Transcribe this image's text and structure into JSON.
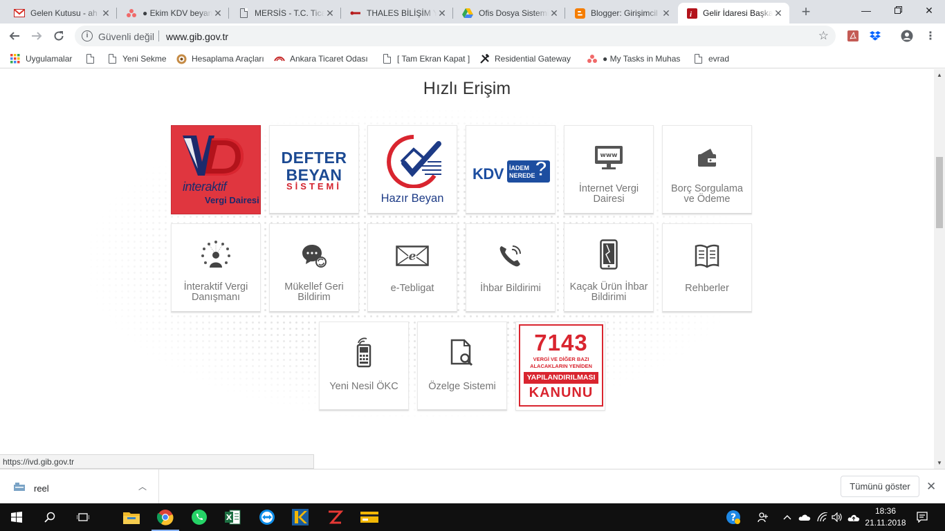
{
  "browser": {
    "tabs": [
      {
        "title": "Gelen Kutusu - ah",
        "icon": "gmail-icon",
        "active": false
      },
      {
        "title": "● Ekim KDV beyan",
        "icon": "asana-icon",
        "active": false
      },
      {
        "title": "MERSİS - T.C. Ticar",
        "icon": "doc-icon",
        "active": false
      },
      {
        "title": "THALES BİLİŞİM YA",
        "icon": "thales-icon",
        "active": false
      },
      {
        "title": "Ofis Dosya Sistemi",
        "icon": "gdrive-icon",
        "active": false
      },
      {
        "title": "Blogger: Girişimcil",
        "icon": "blogger-icon",
        "active": false
      },
      {
        "title": "Gelir İdaresi Başka",
        "icon": "gib-icon",
        "active": true
      }
    ],
    "address": {
      "security": "Güvenli değil",
      "url": "www.gib.gov.tr"
    },
    "bookmarks": [
      {
        "label": "Uygulamalar",
        "icon": "apps-icon"
      },
      {
        "label": "",
        "icon": "doc-icon"
      },
      {
        "label": "Yeni Sekme",
        "icon": "doc-icon"
      },
      {
        "label": "Hesaplama Araçları",
        "icon": "globe-icon"
      },
      {
        "label": "Ankara Ticaret Odası",
        "icon": "ato-icon"
      },
      {
        "label": "[ Tam Ekran Kapat ]",
        "icon": "doc-icon"
      },
      {
        "label": "Residential Gateway",
        "icon": "tools-icon"
      },
      {
        "label": "● My Tasks in Muhas",
        "icon": "asana-icon"
      },
      {
        "label": "evrad",
        "icon": "doc-icon"
      }
    ],
    "status_url": "https://ivd.gib.gov.tr"
  },
  "page": {
    "heading": "Hızlı Erişim",
    "cards": [
      {
        "label": "interaktif",
        "sub": "Vergi Dairesi",
        "logo": "ivd-logo"
      },
      {
        "label": "DEFTER BEYAN",
        "sub": "SİSTEMİ",
        "logo": "defter-beyan-logo"
      },
      {
        "label": "Hazır Beyan",
        "logo": "hazir-beyan-logo"
      },
      {
        "label": "KDV",
        "sub": "İADEM NEREDE",
        "logo": "kdv-iadem-nerede-logo"
      },
      {
        "label": "İnternet Vergi Dairesi",
        "icon": "www-monitor-icon"
      },
      {
        "label": "Borç Sorgulama ve Ödeme",
        "icon": "wallet-card-icon"
      },
      {
        "label": "İnteraktif Vergi Danışmanı",
        "icon": "advisor-network-icon"
      },
      {
        "label": "Mükellef Geri Bildirim",
        "icon": "chat-feedback-icon"
      },
      {
        "label": "e-Tebligat",
        "icon": "e-mail-envelope-icon"
      },
      {
        "label": "İhbar Bildirimi",
        "icon": "phone-call-icon"
      },
      {
        "label": "Kaçak Ürün İhbar Bildirimi",
        "icon": "broken-phone-icon"
      },
      {
        "label": "Rehberler",
        "icon": "open-book-icon"
      },
      {
        "label": "Yeni Nesil ÖKC",
        "icon": "pos-device-icon"
      },
      {
        "label": "Özelge Sistemi",
        "icon": "document-search-icon"
      },
      {
        "label": "7143",
        "sub": "VERGİ VE DİĞER BAZI ALACAKLARIN YENİDEN",
        "band": "YAPILANDIRILMASI",
        "bottom": "KANUNU",
        "logo": "7143-kanunu-logo"
      }
    ]
  },
  "downloads": {
    "file": "reel",
    "show_all": "Tümünü göster"
  },
  "taskbar": {
    "time": "18:36",
    "date": "21.11.2018"
  },
  "colors": {
    "ivd_red": "#e0363f",
    "gib_navy": "#1d2a6b",
    "defter_blue": "#1c4a93",
    "kanun_red": "#d9252f"
  }
}
